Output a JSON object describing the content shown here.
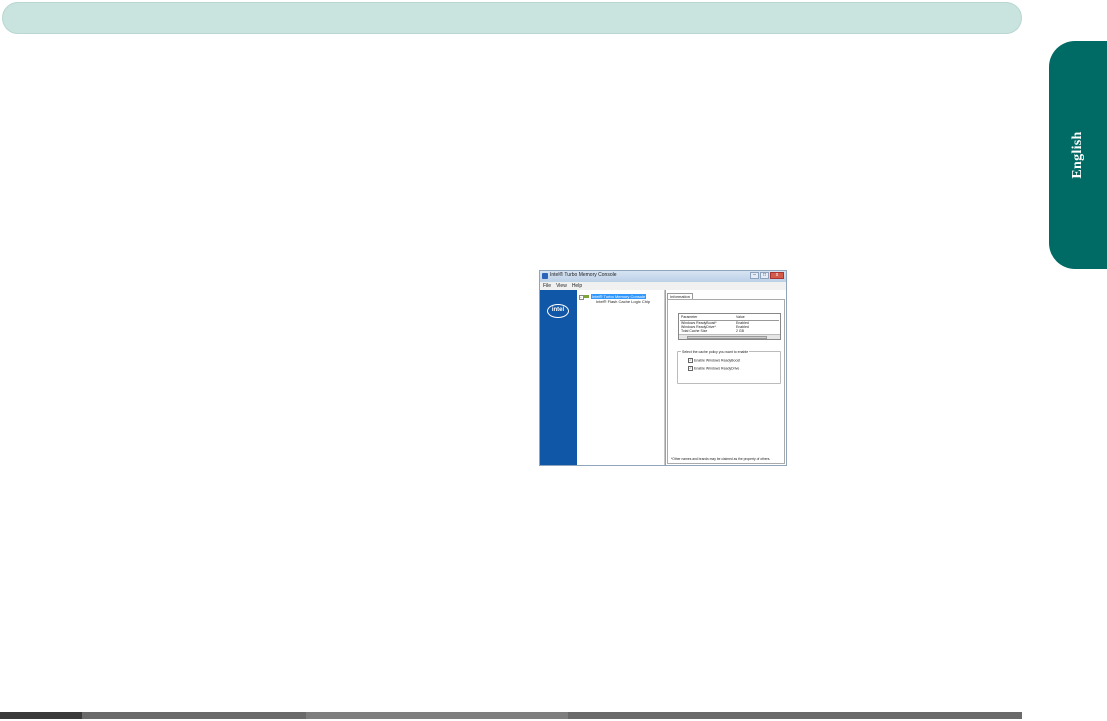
{
  "sidebar_tab": {
    "label": "English"
  },
  "app": {
    "title": "Intel® Turbo Memory Console",
    "menu": [
      "File",
      "View",
      "Help"
    ],
    "window_controls": [
      "–",
      "□",
      "x"
    ],
    "logo_text": "intel",
    "tree": {
      "root": "Intel® Turbo Memory Console",
      "child": "Intel® Flash Cache Logic Chip"
    },
    "tab_label": "Information",
    "table": {
      "headers": [
        "Parameter",
        "Value"
      ],
      "rows": [
        [
          "Windows ReadyBoost*",
          "Enabled"
        ],
        [
          "Windows ReadyDrive*",
          "Enabled"
        ],
        [
          "Total Cache Size",
          "2 GB"
        ]
      ]
    },
    "policy_legend": "Select the cache policy you want to enable",
    "options": [
      "Enable Windows ReadyBoost",
      "Enable Windows ReadyDrive"
    ],
    "footnote": "*Other names and brands may be claimed as the property of others."
  }
}
